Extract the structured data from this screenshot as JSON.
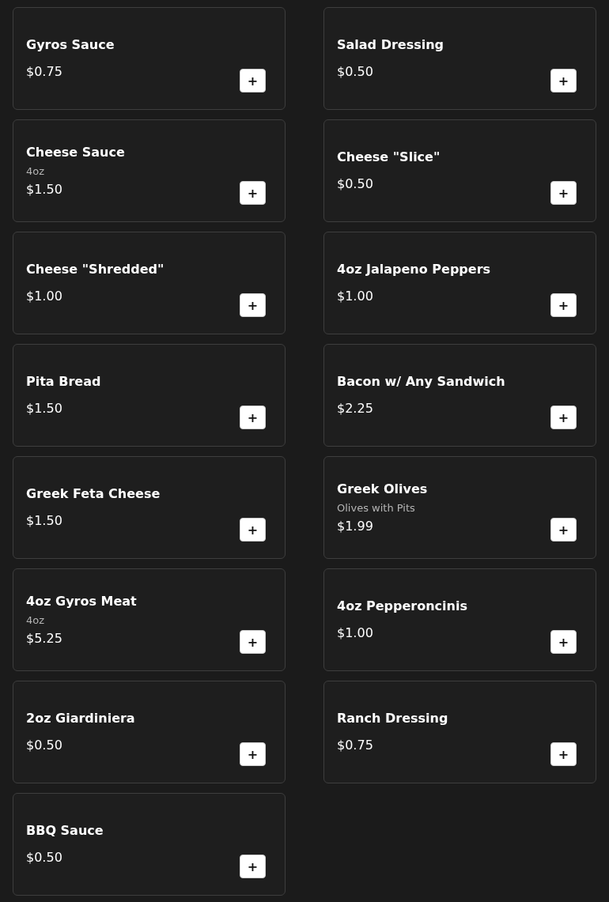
{
  "items": [
    {
      "name": "Gyros Sauce",
      "price": "$0.75",
      "add": "+"
    },
    {
      "name": "Salad Dressing",
      "price": "$0.50",
      "add": "+"
    },
    {
      "name": "Cheese Sauce",
      "description": "4oz",
      "price": "$1.50",
      "add": "+"
    },
    {
      "name": "Cheese \"Slice\"",
      "price": "$0.50",
      "add": "+"
    },
    {
      "name": "Cheese \"Shredded\"",
      "price": "$1.00",
      "add": "+"
    },
    {
      "name": "4oz Jalapeno Peppers",
      "price": "$1.00",
      "add": "+"
    },
    {
      "name": "Pita Bread",
      "price": "$1.50",
      "add": "+"
    },
    {
      "name": "Bacon w/ Any Sandwich",
      "price": "$2.25",
      "add": "+"
    },
    {
      "name": "Greek Feta Cheese",
      "price": "$1.50",
      "add": "+"
    },
    {
      "name": "Greek Olives",
      "description": "Olives with Pits",
      "price": "$1.99",
      "add": "+"
    },
    {
      "name": "4oz Gyros Meat",
      "description": "4oz",
      "price": "$5.25",
      "add": "+"
    },
    {
      "name": "4oz Pepperoncinis",
      "price": "$1.00",
      "add": "+"
    },
    {
      "name": "2oz Giardiniera",
      "price": "$0.50",
      "add": "+"
    },
    {
      "name": "Ranch Dressing",
      "price": "$0.75",
      "add": "+"
    },
    {
      "name": "BBQ Sauce",
      "price": "$0.50",
      "add": "+"
    }
  ]
}
